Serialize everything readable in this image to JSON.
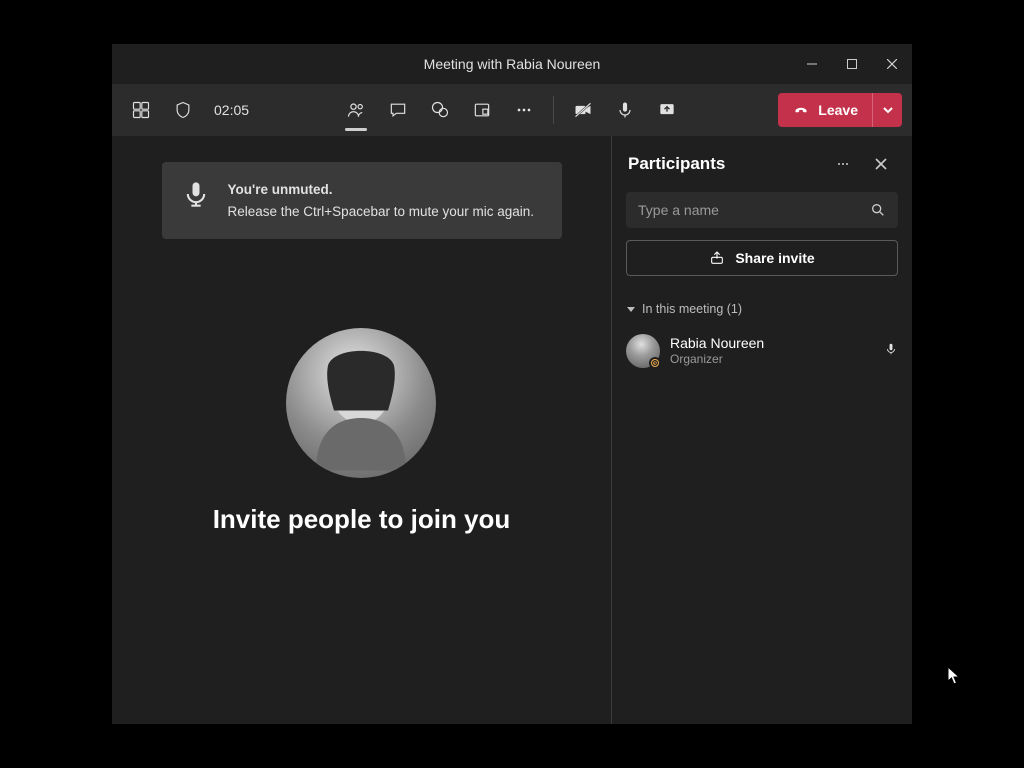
{
  "window": {
    "title": "Meeting with Rabia Noureen"
  },
  "toolbar": {
    "timer": "02:05",
    "leave_label": "Leave"
  },
  "toast": {
    "title": "You're unmuted.",
    "body": "Release the Ctrl+Spacebar to mute your mic again."
  },
  "stage": {
    "invite_text": "Invite people to join you"
  },
  "panel": {
    "title": "Participants",
    "search_placeholder": "Type a name",
    "share_label": "Share invite",
    "section_label": "In this meeting (1)",
    "participants": [
      {
        "name": "Rabia Noureen",
        "role": "Organizer",
        "muted": false,
        "presence": "away"
      }
    ]
  }
}
